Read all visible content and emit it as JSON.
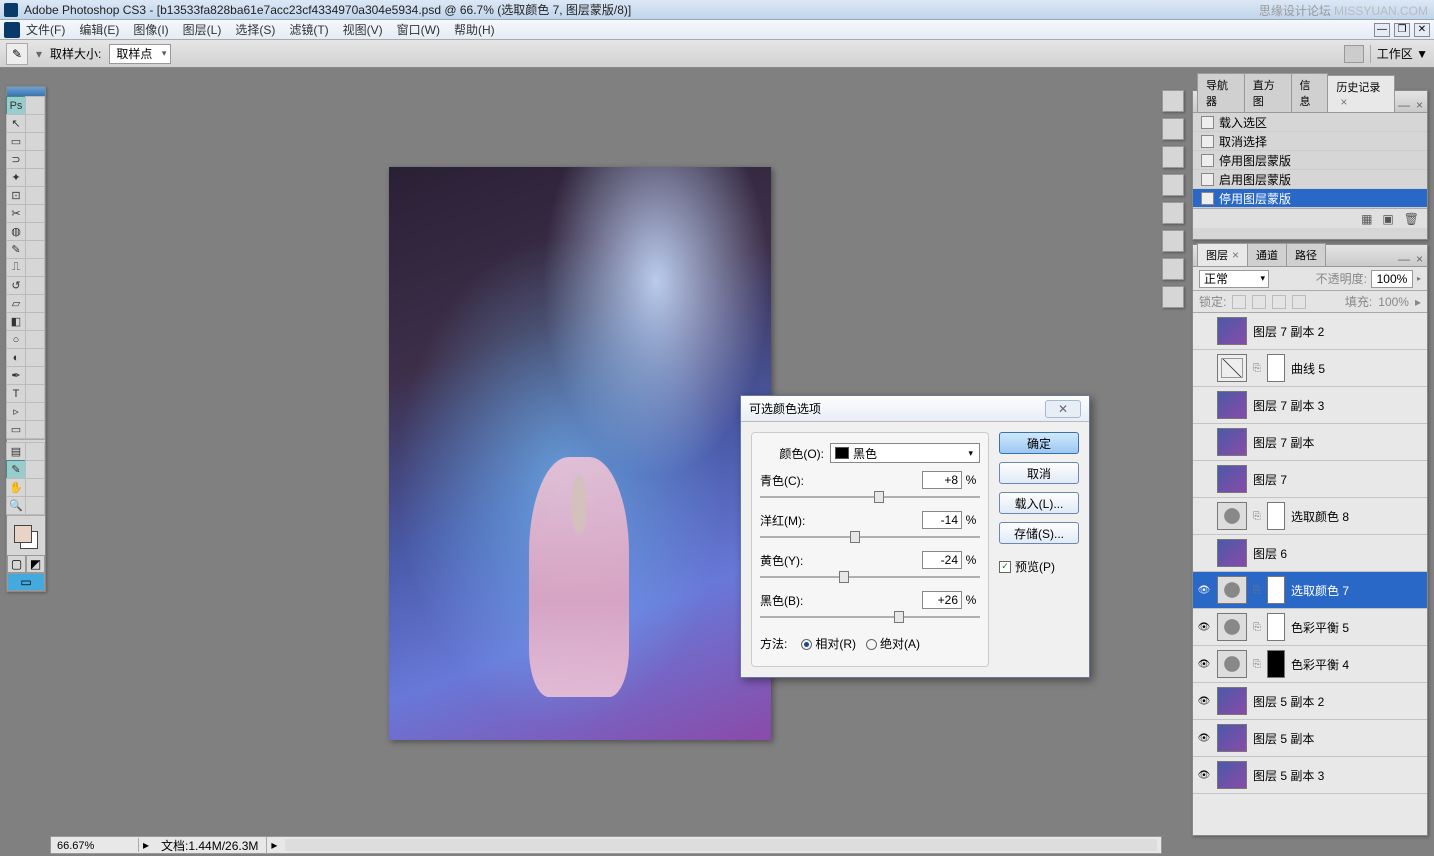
{
  "title": "Adobe Photoshop CS3 - [b13533fa828ba61e7acc23cf4334970a304e5934.psd @ 66.7% (选取颜色 7, 图层蒙版/8)]",
  "watermark_left": "思缘设计论坛",
  "watermark_right": "MISSYUAN.COM",
  "menus": [
    "文件(F)",
    "编辑(E)",
    "图像(I)",
    "图层(L)",
    "选择(S)",
    "滤镜(T)",
    "视图(V)",
    "窗口(W)",
    "帮助(H)"
  ],
  "options": {
    "sample_size_label": "取样大小:",
    "sample_size_value": "取样点",
    "workspace_label": "工作区 ▼"
  },
  "history_panel": {
    "tabs": [
      "导航器",
      "直方图",
      "信息",
      "历史记录"
    ],
    "active_tab": 3,
    "items": [
      {
        "label": "载入选区"
      },
      {
        "label": "取消选择"
      },
      {
        "label": "停用图层蒙版"
      },
      {
        "label": "启用图层蒙版"
      },
      {
        "label": "停用图层蒙版",
        "selected": true
      }
    ]
  },
  "layers_panel": {
    "tabs": [
      "图层",
      "通道",
      "路径"
    ],
    "active_tab": 0,
    "blend_mode": "正常",
    "opacity_label": "不透明度:",
    "opacity_value": "100%",
    "lock_label": "锁定:",
    "fill_label": "填充:",
    "fill_value": "100%",
    "layers": [
      {
        "name": "图层 7 副本 2",
        "visible": false,
        "thumb": "img"
      },
      {
        "name": "曲线 5",
        "visible": false,
        "thumb": "curves",
        "mask": "white"
      },
      {
        "name": "图层 7 副本 3",
        "visible": false,
        "thumb": "img"
      },
      {
        "name": "图层 7 副本",
        "visible": false,
        "thumb": "img"
      },
      {
        "name": "图层 7",
        "visible": false,
        "thumb": "img"
      },
      {
        "name": "选取颜色 8",
        "visible": false,
        "thumb": "adj",
        "mask": "white"
      },
      {
        "name": "图层 6",
        "visible": false,
        "thumb": "img"
      },
      {
        "name": "选取颜色 7",
        "visible": true,
        "thumb": "adj",
        "mask": "white",
        "selected": true
      },
      {
        "name": "色彩平衡 5",
        "visible": true,
        "thumb": "adj",
        "mask": "white"
      },
      {
        "name": "色彩平衡 4",
        "visible": true,
        "thumb": "adj",
        "mask": "black"
      },
      {
        "name": "图层 5 副本 2",
        "visible": true,
        "thumb": "img"
      },
      {
        "name": "图层 5 副本",
        "visible": true,
        "thumb": "img"
      },
      {
        "name": "图层 5 副本 3",
        "visible": true,
        "thumb": "img"
      }
    ]
  },
  "dialog": {
    "title": "可选颜色选项",
    "color_label": "颜色(O):",
    "color_value": "黑色",
    "sliders": [
      {
        "name": "青色(C):",
        "value": "+8",
        "pos": 54
      },
      {
        "name": "洋红(M):",
        "value": "-14",
        "pos": 43
      },
      {
        "name": "黄色(Y):",
        "value": "-24",
        "pos": 38
      },
      {
        "name": "黑色(B):",
        "value": "+26",
        "pos": 63
      }
    ],
    "pct": "%",
    "method_label": "方法:",
    "method_relative": "相对(R)",
    "method_absolute": "绝对(A)",
    "btn_ok": "确定",
    "btn_cancel": "取消",
    "btn_load": "载入(L)...",
    "btn_save": "存储(S)...",
    "preview_label": "预览(P)"
  },
  "status": {
    "zoom": "66.67%",
    "doc_label": "文档:",
    "doc_size": "1.44M/26.3M"
  }
}
